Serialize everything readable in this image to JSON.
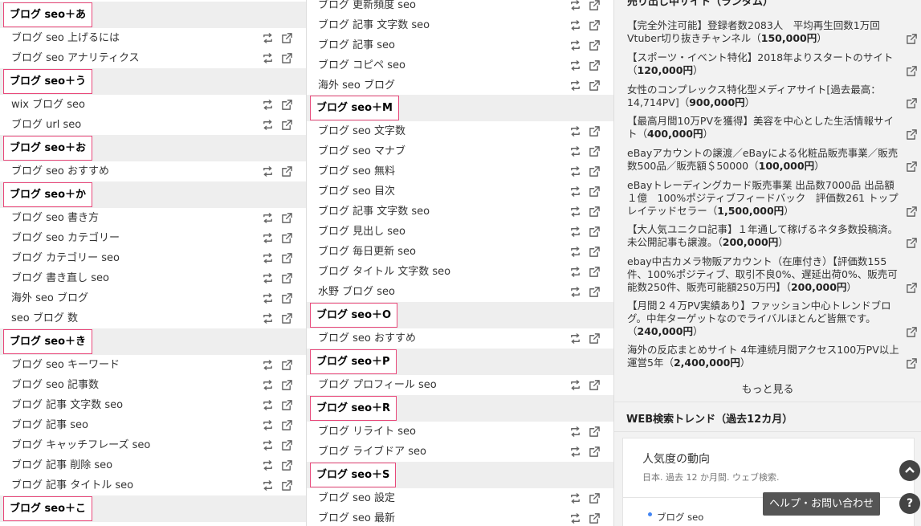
{
  "left_column": [
    {
      "head": "ブログ seo＋あ",
      "items": [
        "ブログ seo 上げるには",
        "ブログ seo アナリティクス"
      ]
    },
    {
      "head": "ブログ seo＋う",
      "items": [
        "wix ブログ seo",
        "ブログ url seo"
      ]
    },
    {
      "head": "ブログ seo＋お",
      "items": [
        "ブログ seo おすすめ"
      ]
    },
    {
      "head": "ブログ seo＋か",
      "items": [
        "ブログ seo 書き方",
        "ブログ seo カテゴリー",
        "ブログ カテゴリー seo",
        "ブログ 書き直し seo",
        "海外 seo ブログ",
        "seo ブログ 数"
      ]
    },
    {
      "head": "ブログ seo＋き",
      "items": [
        "ブログ seo キーワード",
        "ブログ seo 記事数",
        "ブログ 記事 文字数 seo",
        "ブログ 記事 seo",
        "ブログ キャッチフレーズ seo",
        "ブログ 記事 削除 seo",
        "ブログ 記事 タイトル seo"
      ]
    },
    {
      "head": "ブログ seo＋こ",
      "items": []
    }
  ],
  "mid_column_top": [
    "ブログ 更新頻度 seo",
    "ブログ 記事 文字数 seo",
    "ブログ 記事 seo",
    "ブログ コピペ seo",
    "海外 seo ブログ"
  ],
  "mid_column": [
    {
      "head": "ブログ seo＋M",
      "items": [
        "ブログ seo 文字数",
        "ブログ seo マナブ",
        "ブログ seo 無料",
        "ブログ seo 目次",
        "ブログ 記事 文字数 seo",
        "ブログ 見出し seo",
        "ブログ 毎日更新 seo",
        "ブログ タイトル 文字数 seo",
        "水野 ブログ seo"
      ]
    },
    {
      "head": "ブログ seo＋O",
      "items": [
        "ブログ seo おすすめ"
      ]
    },
    {
      "head": "ブログ seo＋P",
      "items": [
        "ブログ プロフィール seo"
      ]
    },
    {
      "head": "ブログ seo＋R",
      "items": [
        "ブログ リライト seo",
        "ブログ ライブドア seo"
      ]
    },
    {
      "head": "ブログ seo＋S",
      "items": [
        "ブログ seo 設定",
        "ブログ seo 最新"
      ]
    }
  ],
  "right": {
    "sale_heading": "売り出し中サイト（ランダム）",
    "sales": [
      {
        "text": "【完全外注可能】登録者数2083人　平均再生回数1万回　Vtuber切り抜きチャンネル",
        "price": "150,000円"
      },
      {
        "text": "【スポーツ・イベント特化】2018年よりスタートのサイト",
        "price": "120,000円"
      },
      {
        "text": "女性のコンプレックス特化型メディアサイト[過去最高：14,714PV]",
        "price": "900,000円"
      },
      {
        "text": "【最高月間10万PVを獲得】美容を中心とした生活情報サイト",
        "price": "400,000円"
      },
      {
        "text": "eBayアカウントの譲渡／eBayによる化粧品販売事業／販売数500品／販売額＄50000",
        "price": "100,000円"
      },
      {
        "text": "eBayトレーディングカード販売事業 出品数7000品 出品額１億　100%ポジティブフィードバック　評価数261 トップレイテッドセラー",
        "price": "1,500,000円"
      },
      {
        "text": "【大人気ユニクロ記事】１年通して稼げるネタ多数投稿済。未公開記事も譲渡。",
        "price": "200,000円"
      },
      {
        "text": "ebay中古カメラ物販アカウント（在庫付き）【評価数155件、100%ポジティブ、取引不良0%、遅延出荷0%、販売可能数250件、販売可能額250万円】",
        "price": "200,000円"
      },
      {
        "text": "【月間２４万PV実績あり】ファッション中心トレンドブログ。中年ターゲットなのでライバルほとんど皆無です。",
        "price": "240,000円"
      },
      {
        "text": "海外の反応まとめサイト 4年連続月間アクセス100万PV以上運営5年",
        "price": "2,400,000円"
      }
    ],
    "more_label": "もっと見る",
    "trend_heading": "WEB検索トレンド（過去12カ月）",
    "trend_title": "人気度の動向",
    "trend_sub": "日本. 過去 12 か月間. ウェブ検索.",
    "legend_label": "ブログ seo"
  },
  "help_label": "ヘルプ・お問い合わせ",
  "help_icon": "?",
  "up_icon": "chevron-up-icon",
  "accent_color": "#e8487a"
}
